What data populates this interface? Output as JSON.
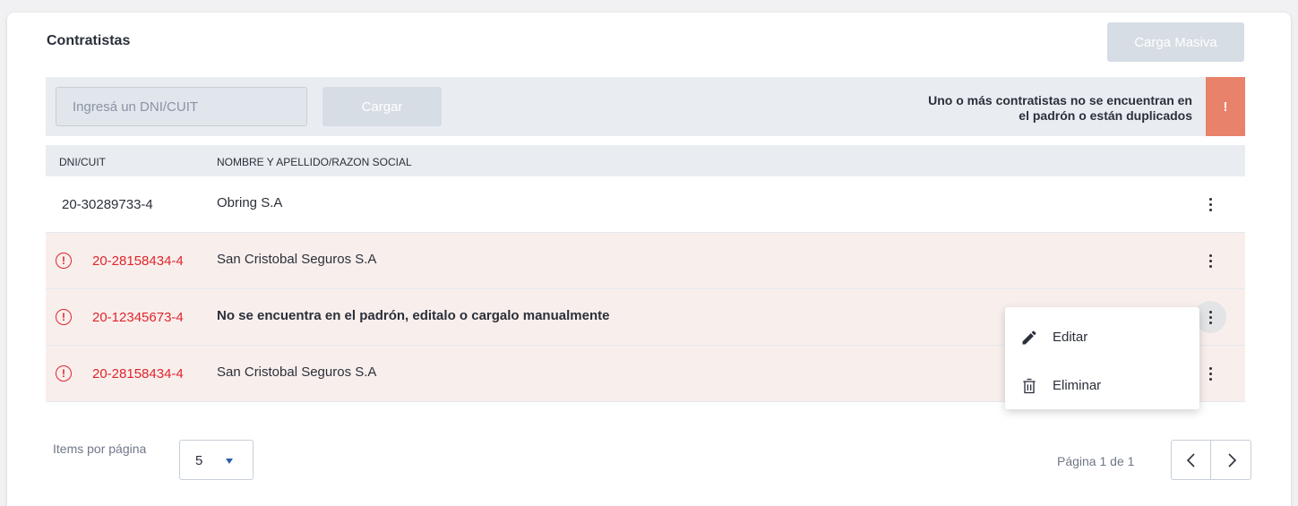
{
  "page": {
    "title": "Contratistas",
    "bulk_button_label": "Carga Masiva"
  },
  "toolbar": {
    "input_placeholder": "Ingresá un DNI/CUIT",
    "input_value": "",
    "load_button_label": "Cargar",
    "warning_line1": "Uno o más contratistas no se encuentran en",
    "warning_line2": "el padrón o están duplicados",
    "warning_badge": "!"
  },
  "table": {
    "columns": [
      "DNI/CUIT",
      "NOMBRE Y APELLIDO/RAZON SOCIAL"
    ],
    "rows": [
      {
        "dni": "20-30289733-4",
        "name": "Obring S.A",
        "error": false
      },
      {
        "dni": "20-28158434-4",
        "name": "San Cristobal Seguros S.A",
        "error": true
      },
      {
        "dni": "20-12345673-4",
        "name": "No se encuentra en el padrón, editalo o cargalo manualmente",
        "error": true
      },
      {
        "dni": "20-28158434-4",
        "name": "San Cristobal Seguros S.A",
        "error": true
      }
    ],
    "error_icon_glyph": "!"
  },
  "context_menu": {
    "items": [
      {
        "label": "Editar",
        "icon": "pencil-icon"
      },
      {
        "label": "Eliminar",
        "icon": "trash-icon"
      }
    ]
  },
  "footer": {
    "items_per_page_label": "Items por página",
    "items_per_page_value": "5",
    "page_info": "Página 1 de 1"
  },
  "colors": {
    "error_red": "#e0242b",
    "warning_badge": "#e8826a",
    "error_row_bg": "#f8efed",
    "header_bg": "#e9edf2",
    "disabled_button": "#d7dde5",
    "dropdown_caret": "#2f5fa8"
  }
}
